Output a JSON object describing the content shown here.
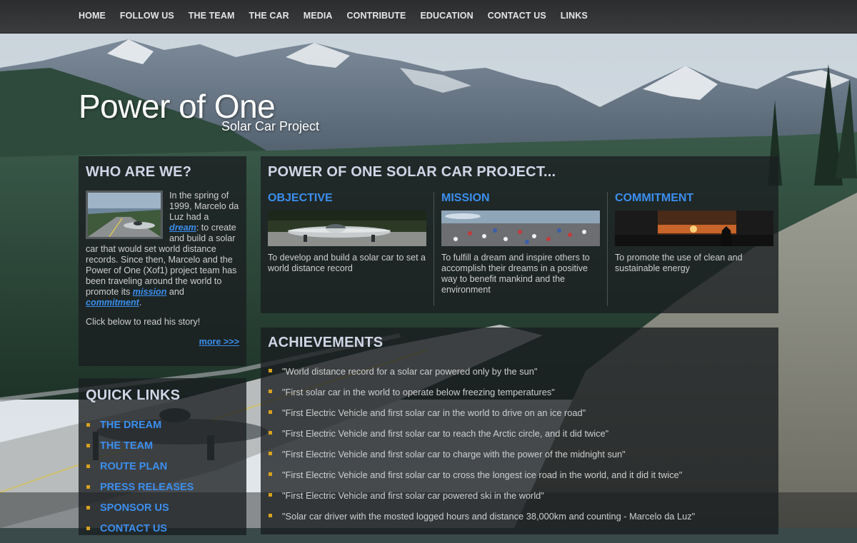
{
  "nav": {
    "items": [
      "HOME",
      "FOLLOW US",
      "THE TEAM",
      "THE CAR",
      "MEDIA",
      "CONTRIBUTE",
      "EDUCATION",
      "CONTACT US",
      "LINKS"
    ]
  },
  "header": {
    "title": "Power of One",
    "subtitle": "Solar Car Project"
  },
  "who": {
    "heading": "WHO ARE WE?",
    "text_1": "In the spring of 1999, Marcelo da Luz had a ",
    "dream_link": "dream",
    "text_2": ": to create and build a solar car that would set world distance records. Since then, Marcelo and the Power of One (Xof1) project team has been traveling around the world to promote its ",
    "mission_link": "mission",
    "text_3": " and ",
    "commitment_link": "commitment",
    "text_4": ".",
    "click_text": "Click below to read his story!",
    "more_link": "more >>>"
  },
  "quick_links": {
    "heading": "QUICK LINKS",
    "items": [
      "THE DREAM",
      "THE TEAM",
      "ROUTE PLAN",
      "PRESS RELEASES",
      "SPONSOR US",
      "CONTACT US"
    ]
  },
  "project": {
    "heading": "POWER OF ONE SOLAR CAR PROJECT...",
    "columns": [
      {
        "title": "OBJECTIVE",
        "text": "To develop and build a solar car to set a world distance record"
      },
      {
        "title": "MISSION",
        "text": "To fulfill a dream and inspire others to accomplish their dreams in a positive way to benefit mankind and the environment"
      },
      {
        "title": "COMMITMENT",
        "text": "To promote the use of clean and sustainable energy"
      }
    ]
  },
  "achievements": {
    "heading": "ACHIEVEMENTS",
    "items": [
      "\"World distance record for a solar car powered only by the sun\"",
      "\"First solar car in the world to operate below freezing temperatures\"",
      "\"First Electric Vehicle and first solar car in the world to drive on an ice road\"",
      "\"First Electric Vehicle and first solar car to reach the Arctic circle, and it did twice\"",
      "\"First Electric Vehicle and first solar car to charge with the power of the midnight sun\"",
      "\"First Electric Vehicle and first solar car to cross the longest ice road in the world, and it did it twice\"",
      "\"First Electric Vehicle and first solar car powered ski in the world\"",
      "\"Solar car driver with the mosted logged hours and distance 38,000km and counting - Marcelo da Luz\""
    ]
  },
  "colors": {
    "link_blue": "#3b8ff0",
    "bullet_gold": "#d9a21d",
    "heading_gray": "#cfd6e6"
  }
}
